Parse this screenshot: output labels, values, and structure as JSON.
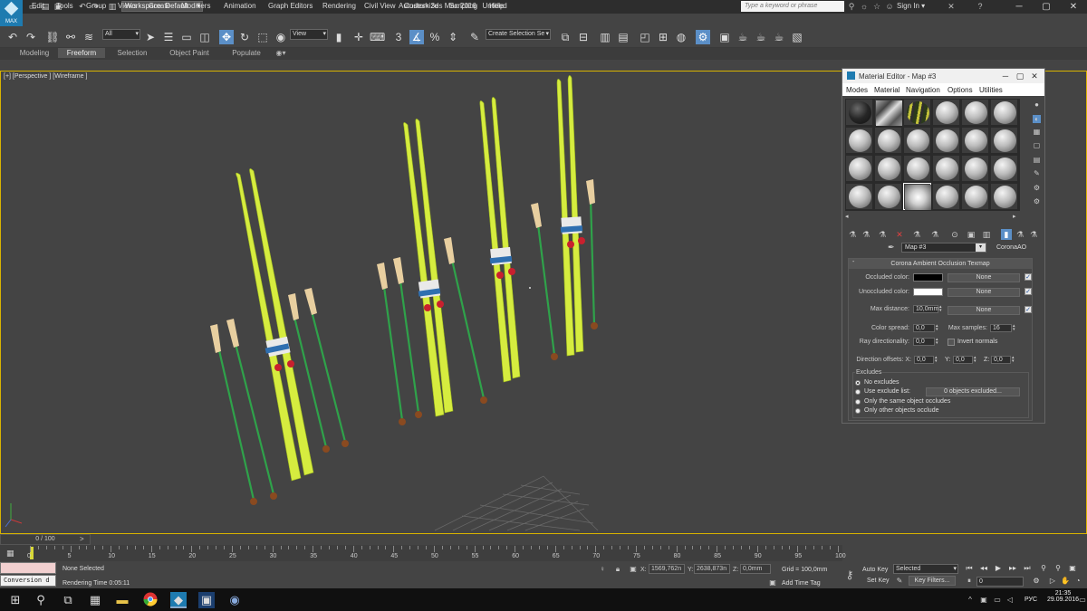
{
  "window": {
    "title": "Autodesk 3ds Max 2016",
    "document": "Untitled",
    "workspace": "Workspace: Default",
    "search_placeholder": "Type a keyword or phrase",
    "sign_in": "Sign In",
    "logo_text": "MAX"
  },
  "menu": [
    "Edit",
    "Tools",
    "Group",
    "Views",
    "Create",
    "Modifiers",
    "Animation",
    "Graph Editors",
    "Rendering",
    "Civil View",
    "Customize",
    "Scripting",
    "Help"
  ],
  "toolbar": {
    "filter_value": "All",
    "ref_coord": "View",
    "named_selection_placeholder": "Create Selection Se",
    "snap_label": "3",
    "angle_snap": "%"
  },
  "ribbon_tabs": [
    "Modeling",
    "Freeform",
    "Selection",
    "Object Paint",
    "Populate"
  ],
  "viewport": {
    "label": "[+] [Perspective ] [Wireframe ]"
  },
  "material_editor": {
    "title": "Material Editor - Map #3",
    "menu": [
      "Modes",
      "Material",
      "Navigation",
      "Options",
      "Utilities"
    ],
    "map_name": "Map #3",
    "map_type": "CoronaAO",
    "rollout_title": "Corona Ambient Occlusion Texmap",
    "params": {
      "occluded_color_label": "Occluded color:",
      "unoccluded_color_label": "Unoccluded color:",
      "max_distance_label": "Max distance:",
      "max_distance_value": "10,0mm",
      "none_label": "None",
      "color_spread_label": "Color spread:",
      "color_spread_value": "0,0",
      "max_samples_label": "Max samples:",
      "max_samples_value": "16",
      "ray_dir_label": "Ray directionality:",
      "ray_dir_value": "0,0",
      "invert_normals_label": "Invert normals",
      "dir_offsets_label": "Direction offsets: X:",
      "y_label": "Y:",
      "z_label": "Z:",
      "offset_x": "0,0",
      "offset_y": "0,0",
      "offset_z": "0,0"
    },
    "occluded_color": "#000000",
    "unoccluded_color": "#ffffff",
    "excludes": {
      "title": "Excludes",
      "options": [
        "No excludes",
        "Use exclude list:",
        "Only the same object occludes",
        "Only other objects occlude"
      ],
      "selected": 0,
      "exclude_button": "0 objects excluded..."
    }
  },
  "timeline": {
    "slider": "0 / 100",
    "ticks": [
      "0",
      "5",
      "10",
      "15",
      "20",
      "25",
      "30",
      "35",
      "40",
      "45",
      "50",
      "55",
      "60",
      "65",
      "70",
      "75",
      "80",
      "85",
      "90",
      "95",
      "100"
    ]
  },
  "status": {
    "script_text": "Conversion d",
    "selection": "None Selected",
    "render_time": "Rendering Time  0:05:11",
    "x_label": "X:",
    "x_value": "1569,762n",
    "y_label": "Y:",
    "y_value": "2638,873n",
    "z_label": "Z:",
    "z_value": "0,0mm",
    "grid": "Grid = 100,0mm",
    "add_time_tag": "Add Time Tag",
    "auto_key": "Auto Key",
    "auto_key_mode": "Selected",
    "set_key": "Set Key",
    "key_filters": "Key Filters...",
    "current_frame": "0"
  },
  "taskbar": {
    "language": "РУС",
    "time": "21:35",
    "date": "29.09.2016"
  },
  "colors": {
    "ski": "#d6ec3f",
    "pole": "#2fa24a",
    "grip": "#e8cfa0",
    "viewport_border": "#d8b300",
    "accent": "#5b8fc7"
  }
}
